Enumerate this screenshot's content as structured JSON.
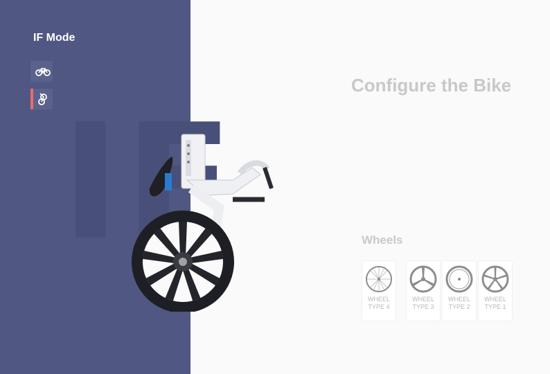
{
  "sidebar": {
    "watermark": "IF",
    "title": "IF Mode",
    "modes": [
      {
        "icon": "bike-icon",
        "active": false
      },
      {
        "icon": "folded-bike-icon",
        "active": true
      }
    ]
  },
  "main": {
    "headline": "Configure the Bike"
  },
  "wheels": {
    "title": "Wheels",
    "options": [
      {
        "label": "WHEEL TYPE 4",
        "icon": "spoked-wheel-icon"
      },
      {
        "label": "WHEEL TYPE 3",
        "icon": "tri-spoke-wheel-icon"
      },
      {
        "label": "WHEEL TYPE 2",
        "icon": "disc-wheel-icon"
      },
      {
        "label": "WHEEL TYPE 1",
        "icon": "five-spoke-wheel-icon"
      }
    ]
  },
  "colors": {
    "sidebar": "#4f5782",
    "accent": "#ec6a6a",
    "muted_text": "#c8c8c8"
  }
}
